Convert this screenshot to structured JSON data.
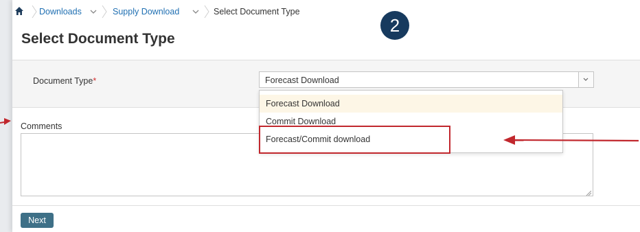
{
  "breadcrumb": {
    "items": [
      "Downloads",
      "Supply Download"
    ],
    "current": "Select Document Type"
  },
  "annotation": {
    "step_number": "2"
  },
  "page": {
    "title": "Select Document Type"
  },
  "form": {
    "document_type": {
      "label": "Document Type",
      "required_marker": "*",
      "selected_value": "Forecast Download",
      "options": [
        "Forecast Download",
        "Commit Download",
        "Forecast/Commit download"
      ],
      "highlighted_option": "Forecast/Commit download"
    },
    "comments": {
      "label": "Comments",
      "value": ""
    },
    "next_label": "Next"
  },
  "colors": {
    "link": "#1f6fb2",
    "badge": "#173a5e",
    "annotation_red": "#c1272d",
    "button": "#3e7087",
    "option_hover": "#fdf6e6"
  },
  "icons": [
    "home-icon",
    "chevron-down-icon",
    "resize-grip-icon",
    "arrow-left-icon",
    "arrow-right-icon"
  ]
}
